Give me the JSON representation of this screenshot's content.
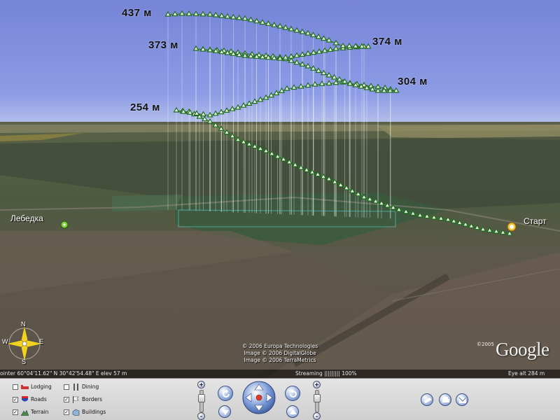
{
  "map": {
    "altitude_labels": [
      "437 м",
      "373 м",
      "374 м",
      "304 м",
      "254 м"
    ],
    "places": {
      "left": "Лебедка",
      "right": "Старт"
    },
    "compass": {
      "n": "N",
      "s": "S",
      "e": "E",
      "w": "W"
    },
    "copyright": [
      "© 2006 Europa Technologies",
      "Image © 2006 DigitalGlobe",
      "Image © 2006 TerraMetrics"
    ],
    "google": {
      "year": "©2005",
      "logo": "Google"
    }
  },
  "status": {
    "pointer": "ointer  60°04'11.62\" N   30°42'54.48\" E   elev   57 m",
    "streaming": "Streaming ||||||||| 100%",
    "eye_alt": "Eye  alt      284 m"
  },
  "layers": [
    {
      "label": "Lodging",
      "checked": false,
      "icon": "bed-icon"
    },
    {
      "label": "Dining",
      "checked": false,
      "icon": "fork-knife-icon"
    },
    {
      "label": "Roads",
      "checked": true,
      "icon": "road-shield-icon"
    },
    {
      "label": "Borders",
      "checked": true,
      "icon": "flag-icon"
    },
    {
      "label": "Terrain",
      "checked": true,
      "icon": "mountain-icon"
    },
    {
      "label": "Buildings",
      "checked": true,
      "icon": "building-icon"
    }
  ],
  "controls": {
    "zoom_in": "+",
    "zoom_out": "-",
    "tilt_up": "+",
    "tilt_down": "-"
  },
  "colors": {
    "sky": "#7e8fdc",
    "track": "#2e7d2e",
    "toolbar": "#d8d8d8",
    "nav_blue": "#5a7fd0"
  },
  "chart_data": {
    "type": "line",
    "title": "",
    "point_labels": [
      {
        "label": "437 м",
        "value": 437
      },
      {
        "label": "373 м",
        "value": 373
      },
      {
        "label": "374 м",
        "value": 374
      },
      {
        "label": "304 м",
        "value": 304
      },
      {
        "label": "254 м",
        "value": 254
      }
    ]
  }
}
